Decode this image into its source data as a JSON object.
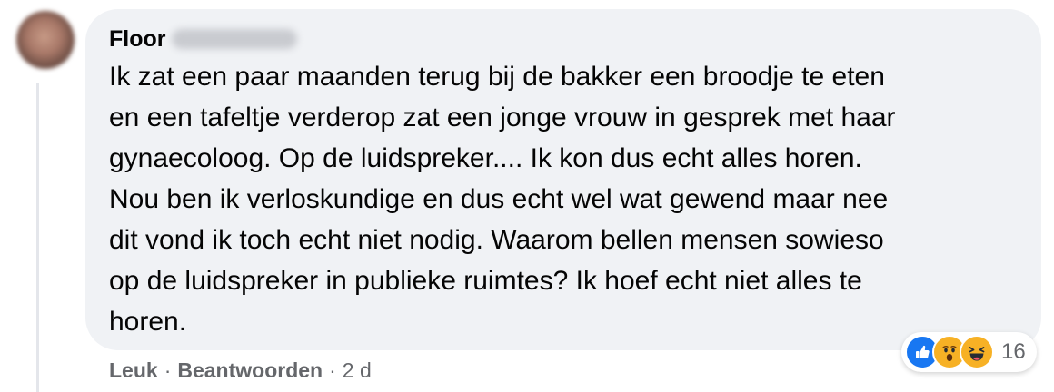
{
  "comment": {
    "author": "Floor",
    "text": "Ik zat een paar maanden terug bij de bakker een broodje te eten\nen een tafeltje verderop zat een jonge vrouw in gesprek met haar\ngynaecoloog. Op de luidspreker.... Ik kon dus echt alles horen.\nNou ben ik verloskundige en dus echt wel wat gewend maar nee\ndit vond ik toch echt niet nodig. Waarom bellen mensen sowieso\nop de luidspreker in publieke ruimtes? Ik hoef echt niet alles te\nhoren."
  },
  "actions": {
    "like_label": "Leuk",
    "reply_label": "Beantwoorden",
    "separator": "·",
    "time": "2 d"
  },
  "reactions": {
    "icons": [
      "like-icon",
      "wow-icon",
      "haha-icon"
    ],
    "count": "16"
  },
  "colors": {
    "bubble": "#f0f2f5",
    "text": "#050505",
    "secondary": "#65676b",
    "like_blue": "#1877f2",
    "emoji_yellow": "#f7b125"
  }
}
